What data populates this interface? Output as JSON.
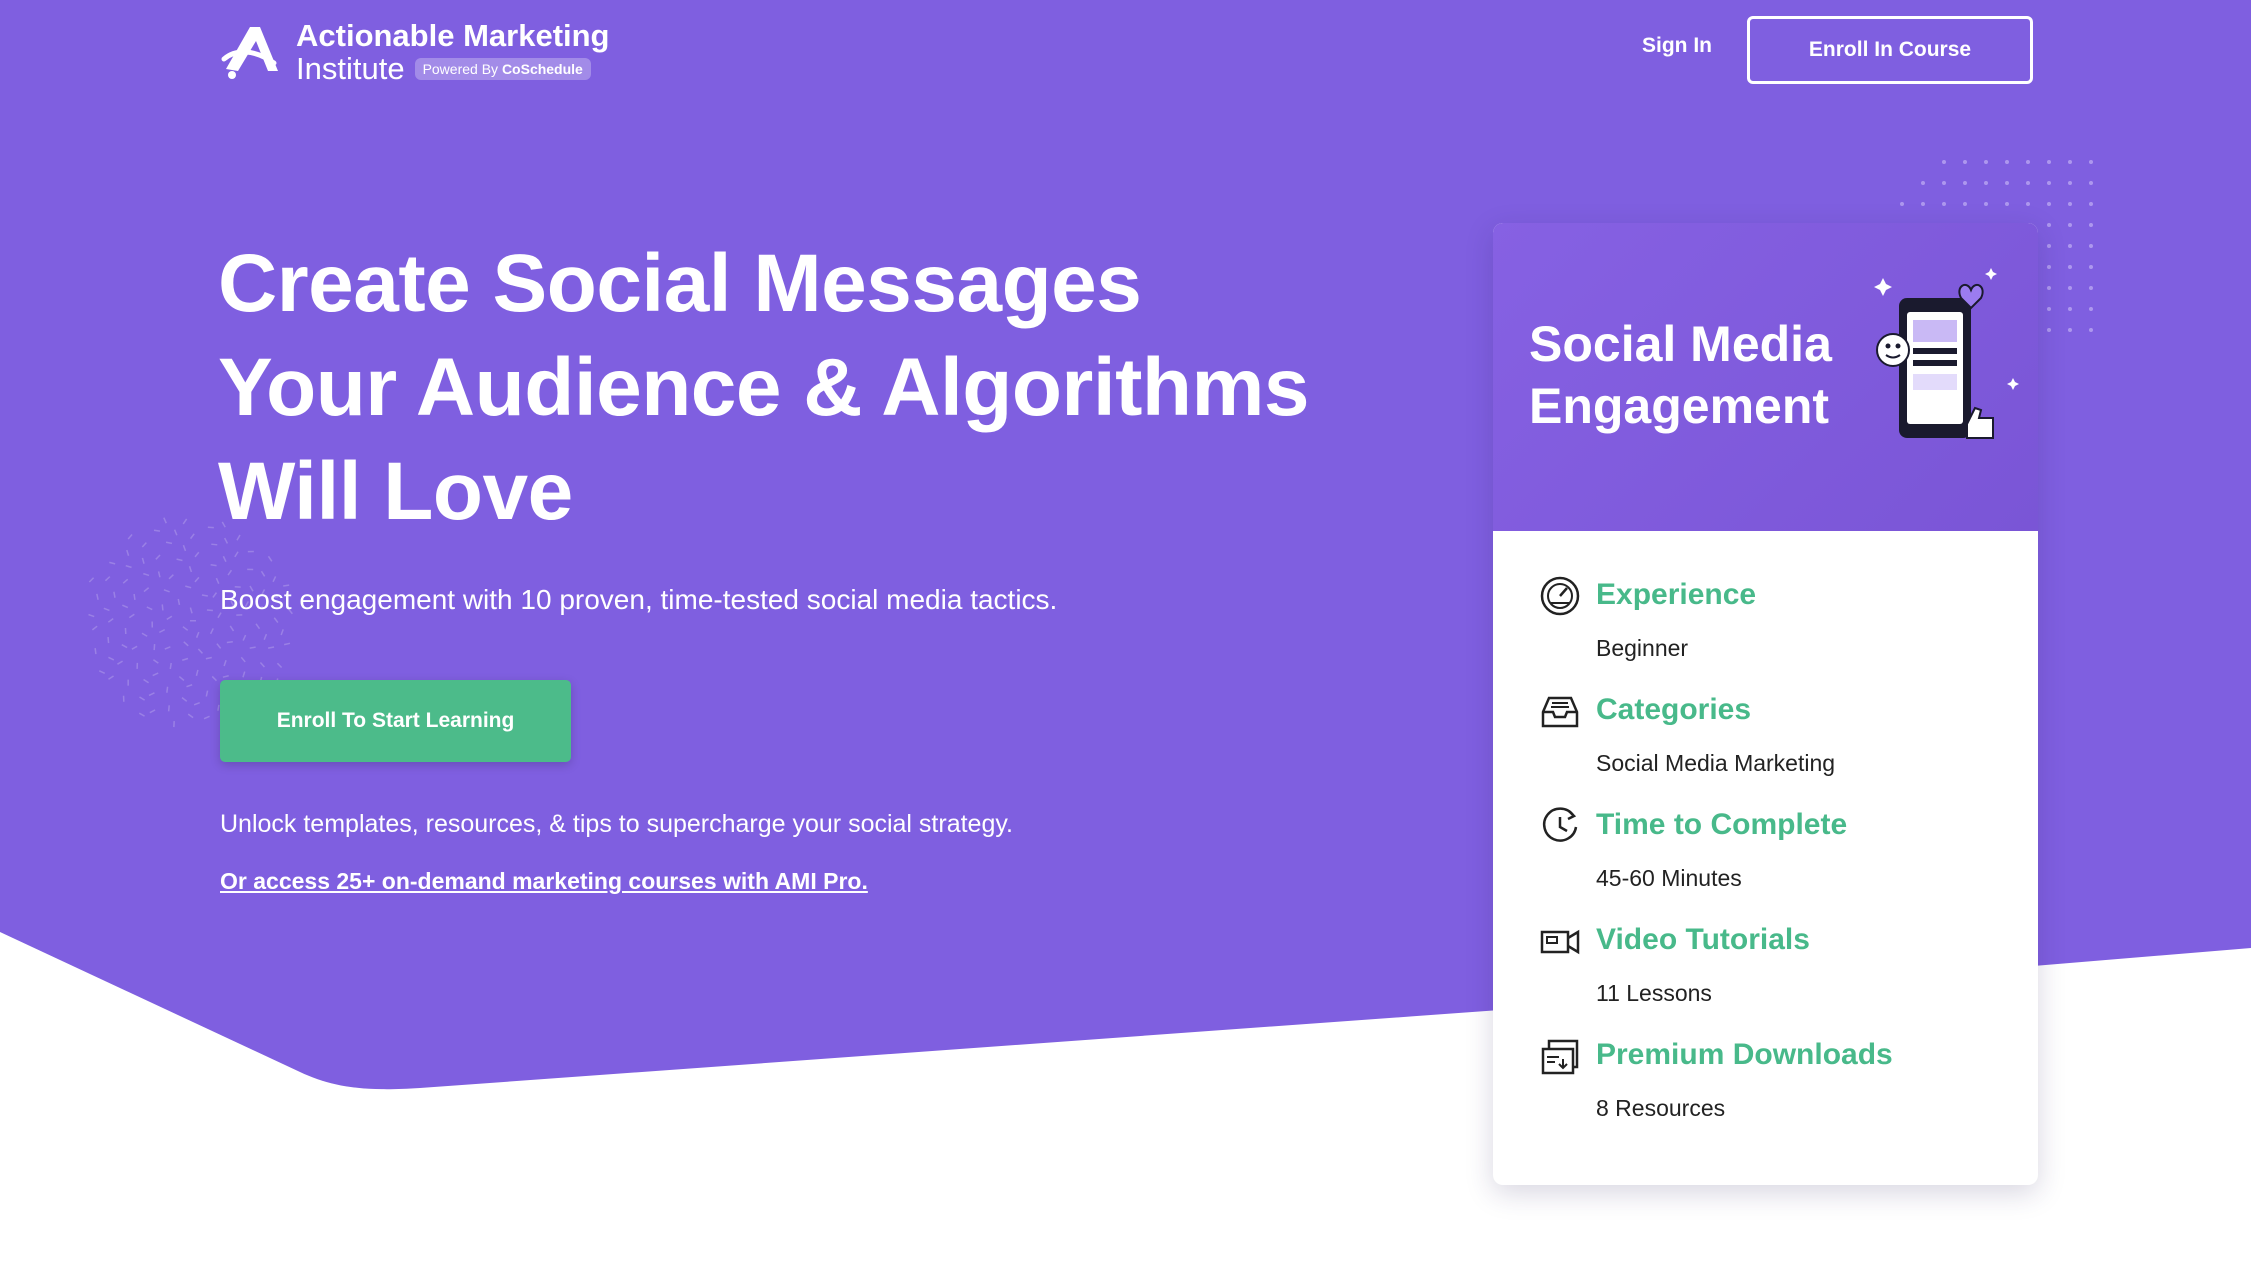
{
  "colors": {
    "hero_purple": "#7f5fe0",
    "accent_green": "#4cbb8a",
    "white": "#ffffff",
    "text_dark": "#222222"
  },
  "header": {
    "logo_line1": "Actionable Marketing",
    "logo_line2": "Institute",
    "logo_badge_prefix": "Powered By",
    "logo_badge_brand": "CoSchedule",
    "signin_label": "Sign In",
    "enroll_label": "Enroll In Course"
  },
  "hero": {
    "headline": "Create Social Messages Your Audience & Algorithms Will Love",
    "subline": "Boost engagement with 10 proven, time-tested social media tactics.",
    "cta_label": "Enroll To Start Learning",
    "unlock_text": "Unlock templates, resources, & tips to supercharge your social strategy.",
    "pro_link": "Or access 25+ on-demand marketing courses with AMI Pro."
  },
  "course_card": {
    "title": "Social Media Engagement",
    "details": [
      {
        "icon": "speedometer-icon",
        "label": "Experience",
        "value": "Beginner"
      },
      {
        "icon": "inbox-tray-icon",
        "label": "Categories",
        "value": "Social Media Marketing"
      },
      {
        "icon": "clock-refresh-icon",
        "label": "Time to Complete",
        "value": "45-60 Minutes"
      },
      {
        "icon": "video-camera-icon",
        "label": "Video Tutorials",
        "value": "11 Lessons"
      },
      {
        "icon": "folder-download-icon",
        "label": "Premium Downloads",
        "value": "8 Resources"
      }
    ]
  }
}
